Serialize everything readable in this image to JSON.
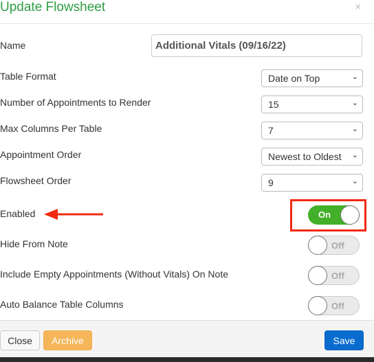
{
  "dialog": {
    "title": "Update Flowsheet",
    "close_icon": "×"
  },
  "fields": {
    "name": {
      "label": "Name",
      "value": "Additional Vitals (09/16/22)"
    },
    "table_format": {
      "label": "Table Format",
      "value": "Date on Top"
    },
    "num_appointments": {
      "label": "Number of Appointments to Render",
      "value": "15"
    },
    "max_columns": {
      "label": "Max Columns Per Table",
      "value": "7"
    },
    "appointment_order": {
      "label": "Appointment Order",
      "value": "Newest to Oldest"
    },
    "flowsheet_order": {
      "label": "Flowsheet Order",
      "value": "9"
    },
    "enabled": {
      "label": "Enabled",
      "state": "On"
    },
    "hide_from_note": {
      "label": "Hide From Note",
      "state": "Off"
    },
    "include_empty": {
      "label": "Include Empty Appointments (Without Vitals) On Note",
      "state": "Off"
    },
    "auto_balance": {
      "label": "Auto Balance Table Columns",
      "state": "Off"
    }
  },
  "footer": {
    "close": "Close",
    "archive": "Archive",
    "save": "Save"
  },
  "colors": {
    "title": "#2e9e44",
    "toggle_on": "#43b02a",
    "archive": "#f5b65a",
    "save": "#0a6ccf",
    "annotation": "#f22a10"
  }
}
